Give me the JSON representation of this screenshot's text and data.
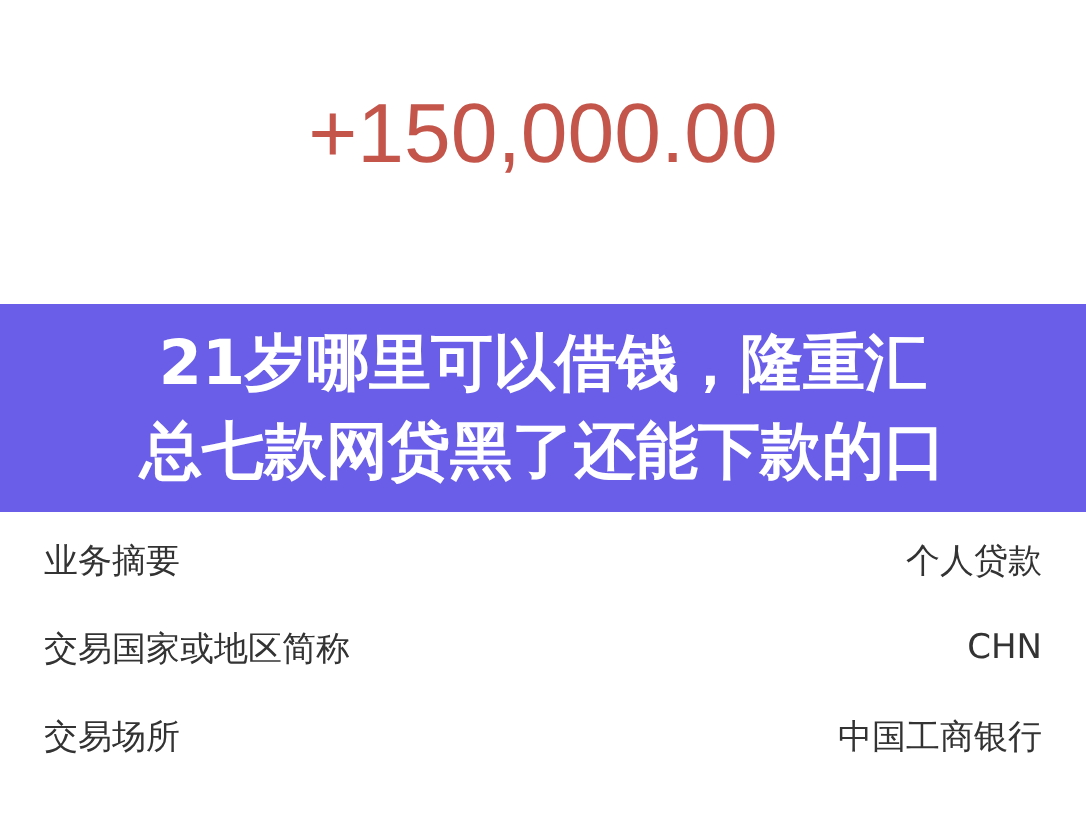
{
  "amount": "+150,000.00",
  "banner": {
    "lines": [
      "21岁哪里可以借钱，隆重汇",
      "总七款网贷黑了还能下款的口"
    ]
  },
  "details": [
    {
      "label": "业务摘要",
      "value": "个人贷款"
    },
    {
      "label": "交易国家或地区简称",
      "value": "CHN"
    },
    {
      "label": "交易场所",
      "value": "中国工商银行"
    }
  ]
}
